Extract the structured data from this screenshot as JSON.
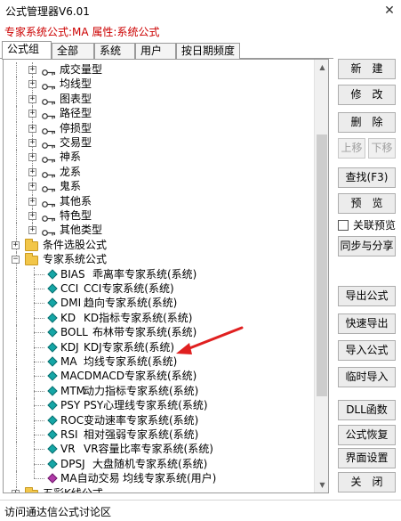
{
  "window": {
    "title": "公式管理器V6.01",
    "close_glyph": "✕"
  },
  "info_line": "专家系统公式:MA 属性:系统公式",
  "tabs": [
    "公式组",
    "全部",
    "系统",
    "用户",
    "按日期频度"
  ],
  "tree": {
    "group_children": [
      "成交量型",
      "均线型",
      "图表型",
      "路径型",
      "停损型",
      "交易型",
      "神系",
      "龙系",
      "鬼系",
      "其他系",
      "特色型",
      "其他类型"
    ],
    "categories": {
      "condition": "条件选股公式",
      "expert": "专家系统公式",
      "colorful": "五彩K线公式"
    },
    "expert_items": [
      {
        "code": "BIAS",
        "desc": "乖离率专家系统(系统)",
        "kind": "system"
      },
      {
        "code": "CCI",
        "desc": "CCI专家系统(系统)",
        "kind": "system"
      },
      {
        "code": "DMI",
        "desc": "趋向专家系统(系统)",
        "kind": "system"
      },
      {
        "code": "KD",
        "desc": "KD指标专家系统(系统)",
        "kind": "system"
      },
      {
        "code": "BOLL",
        "desc": "布林带专家系统(系统)",
        "kind": "system"
      },
      {
        "code": "KDJ",
        "desc": "KDJ专家系统(系统)",
        "kind": "system"
      },
      {
        "code": "MA",
        "desc": "均线专家系统(系统)",
        "kind": "system"
      },
      {
        "code": "MACD",
        "desc": "MACD专家系统(系统)",
        "kind": "system"
      },
      {
        "code": "MTM",
        "desc": "动力指标专家系统(系统)",
        "kind": "system"
      },
      {
        "code": "PSY",
        "desc": "PSY心理线专家系统(系统)",
        "kind": "system"
      },
      {
        "code": "ROC",
        "desc": "变动速率专家系统(系统)",
        "kind": "system"
      },
      {
        "code": "RSI",
        "desc": "相对强弱专家系统(系统)",
        "kind": "system"
      },
      {
        "code": "VR",
        "desc": "VR容量比率专家系统(系统)",
        "kind": "system"
      },
      {
        "code": "DPSJ",
        "desc": "大盘随机专家系统(系统)",
        "kind": "system"
      },
      {
        "code": "MA自动交易",
        "desc": "均线专家系统(用户)",
        "kind": "user"
      }
    ]
  },
  "buttons": {
    "new": "新　建",
    "modify": "修　改",
    "delete": "删　除",
    "move_up": "上移",
    "move_down": "下移",
    "find": "查找(F3)",
    "preview": "预　览",
    "close_preview": "关联预览",
    "sync_share": "同步与分享",
    "export": "导出公式",
    "quick_export": "快速导出",
    "import": "导入公式",
    "temp_import": "临时导入",
    "dll": "DLL函数",
    "restore": "公式恢复",
    "ui_settings": "界面设置",
    "close": "关　闭"
  },
  "status_text": "访问通达信公式讨论区",
  "colors": {
    "info_red": "#cc0000",
    "annotation_arrow": "#e02020",
    "system_gem": "#15a6a6",
    "user_gem": "#b03aa8",
    "folder": "#f2c649"
  }
}
